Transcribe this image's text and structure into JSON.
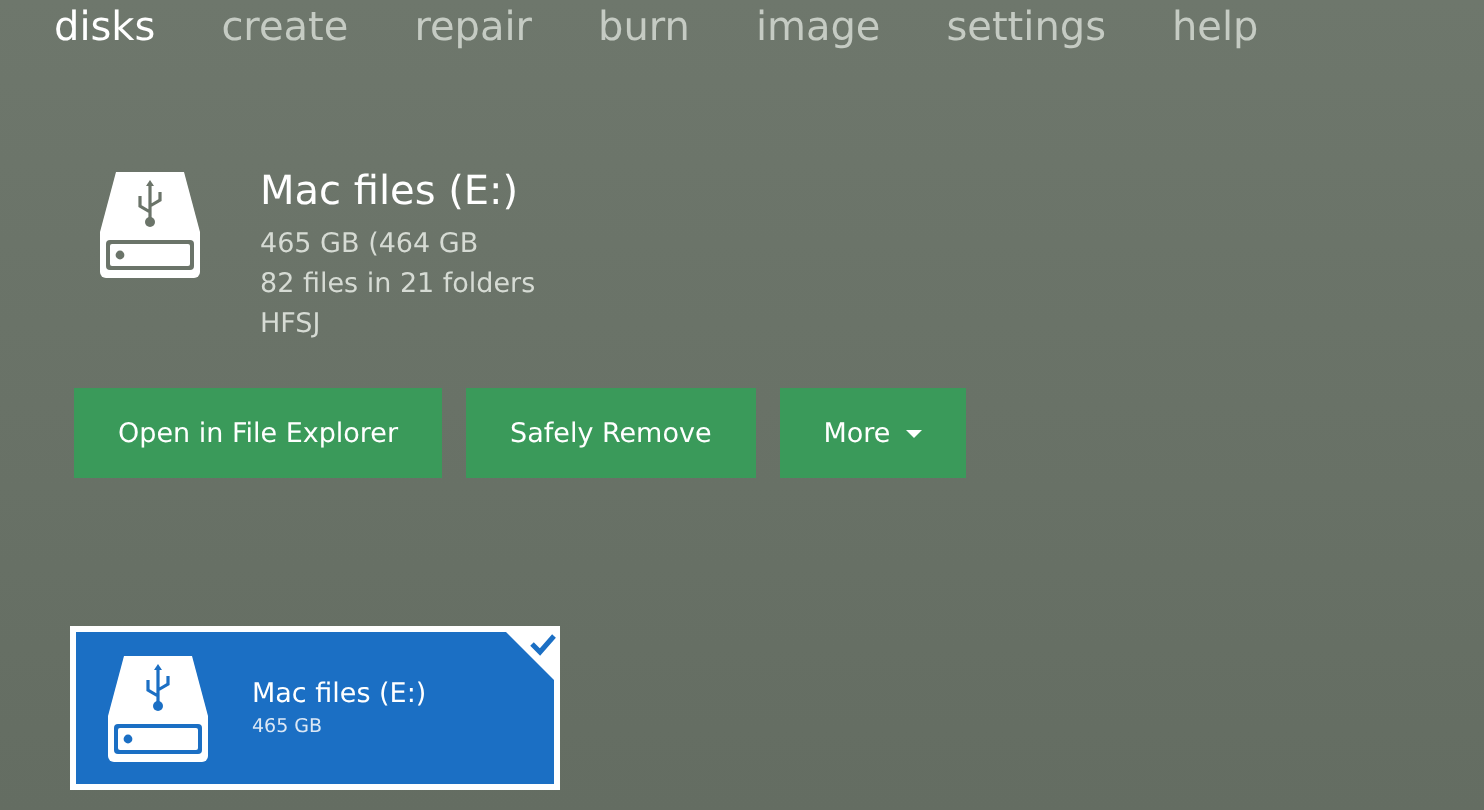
{
  "nav": [
    {
      "label": "disks",
      "selected": true
    },
    {
      "label": "create",
      "selected": false
    },
    {
      "label": "repair",
      "selected": false
    },
    {
      "label": "burn",
      "selected": false
    },
    {
      "label": "image",
      "selected": false
    },
    {
      "label": "settings",
      "selected": false
    },
    {
      "label": "help",
      "selected": false
    }
  ],
  "disk": {
    "name": "Mac files (E:)",
    "details": [
      "465 GB (464 GB",
      "82 files in 21 folders",
      "HFSJ"
    ]
  },
  "actions": [
    {
      "label": "Open in File Explorer",
      "kind": "plain"
    },
    {
      "label": "Safely Remove",
      "kind": "plain"
    },
    {
      "label": "More",
      "kind": "dropdown"
    }
  ],
  "tiles": [
    {
      "name": "Mac files (E:)",
      "size": "465 GB",
      "selected": true
    }
  ]
}
